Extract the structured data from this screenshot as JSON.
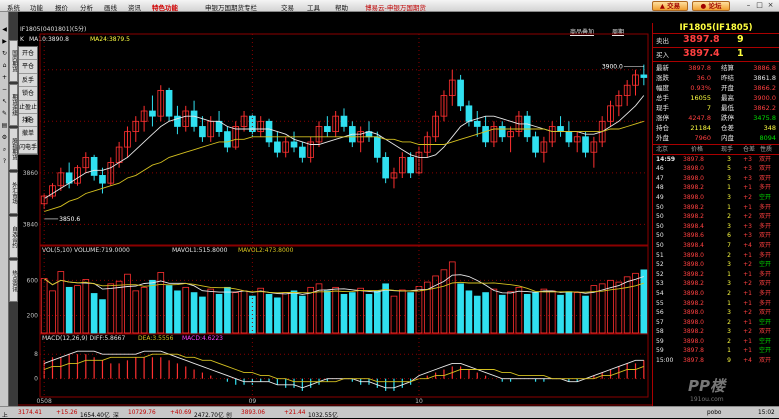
{
  "menu": [
    "系统",
    "功能",
    "报价",
    "分析",
    "画线",
    "资讯",
    "特色功能",
    "申银万国期货专栏",
    "交易",
    "工具",
    "帮助"
  ],
  "active_menu": "特色功能",
  "app_title": "博易云-申银万国期货",
  "trade_btn": "交易",
  "forum_btn": "论坛",
  "winctl": [
    "–",
    "□",
    "×"
  ],
  "toolbar_icons": [
    "back-icon",
    "forward-icon",
    "refresh-icon",
    "home-icon",
    "zoom-in-icon",
    "zoom-out-icon",
    "cursor-icon",
    "draw-icon",
    "print-icon",
    "settings-icon",
    "search-icon",
    "help-icon"
  ],
  "side_tabs": [
    "国内期货",
    "期货连续",
    "股指期货",
    "外汇市场",
    "自选合约",
    "热点资讯"
  ],
  "info": {
    "contract": "IF1805(0401801)(5分)",
    "k": "K",
    "ma10": "MA10:3890.8",
    "ma24": "MA24:3879.5",
    "link1": "商品叠加",
    "link2": "周期"
  },
  "vmenu": [
    "开仓",
    "平仓",
    "反手",
    "锁仓",
    "止盈止损",
    "持仓",
    "撤单",
    "闪电手"
  ],
  "vol_info": {
    "label": "VOL(5,10)",
    "volume": "VOLUME:719.0000",
    "mavol1": "MAVOL1:515.8000",
    "mavol2": "MAVOL2:473.8000"
  },
  "macd_info": {
    "label": "MACD(12,26,9)",
    "dif": "DIFF:5.8667",
    "dea": "DEA:3.5556",
    "macd": "MACD:4.6223"
  },
  "colors": {
    "up": "#ff3030",
    "down": "#30e0f0",
    "ma1": "#e8e8e8",
    "ma2": "#d4c020",
    "bg": "#000000",
    "grid": "#8b0000"
  },
  "chart_data": {
    "type": "candlestick",
    "yticks": [
      "3900",
      "3880",
      "3860",
      "3840"
    ],
    "ylim": [
      3832,
      3910
    ],
    "annotations": [
      {
        "text": "3900.0",
        "note": "high"
      },
      {
        "text": "3850.6",
        "note": "low"
      }
    ],
    "xticks": [
      "0508",
      "09",
      "10"
    ],
    "vol_yticks": [
      "600",
      "200"
    ],
    "macd_yticks": [
      "8",
      "0"
    ],
    "candles": [
      {
        "o": 3848,
        "h": 3852,
        "l": 3846,
        "c": 3851
      },
      {
        "o": 3851,
        "h": 3856,
        "l": 3850,
        "c": 3855
      },
      {
        "o": 3855,
        "h": 3862,
        "l": 3853,
        "c": 3860
      },
      {
        "o": 3860,
        "h": 3864,
        "l": 3854,
        "c": 3856
      },
      {
        "o": 3856,
        "h": 3863,
        "l": 3855,
        "c": 3862
      },
      {
        "o": 3862,
        "h": 3868,
        "l": 3860,
        "c": 3866
      },
      {
        "o": 3866,
        "h": 3867,
        "l": 3857,
        "c": 3859
      },
      {
        "o": 3859,
        "h": 3862,
        "l": 3852,
        "c": 3856
      },
      {
        "o": 3856,
        "h": 3866,
        "l": 3855,
        "c": 3864
      },
      {
        "o": 3864,
        "h": 3872,
        "l": 3862,
        "c": 3870
      },
      {
        "o": 3870,
        "h": 3878,
        "l": 3866,
        "c": 3876
      },
      {
        "o": 3876,
        "h": 3882,
        "l": 3872,
        "c": 3880
      },
      {
        "o": 3880,
        "h": 3886,
        "l": 3876,
        "c": 3884
      },
      {
        "o": 3884,
        "h": 3890,
        "l": 3878,
        "c": 3882
      },
      {
        "o": 3882,
        "h": 3894,
        "l": 3880,
        "c": 3892
      },
      {
        "o": 3892,
        "h": 3893,
        "l": 3880,
        "c": 3882
      },
      {
        "o": 3882,
        "h": 3886,
        "l": 3875,
        "c": 3878
      },
      {
        "o": 3878,
        "h": 3886,
        "l": 3876,
        "c": 3884
      },
      {
        "o": 3884,
        "h": 3888,
        "l": 3876,
        "c": 3878
      },
      {
        "o": 3878,
        "h": 3882,
        "l": 3872,
        "c": 3874
      },
      {
        "o": 3874,
        "h": 3882,
        "l": 3872,
        "c": 3880
      },
      {
        "o": 3880,
        "h": 3884,
        "l": 3874,
        "c": 3876
      },
      {
        "o": 3876,
        "h": 3878,
        "l": 3868,
        "c": 3870
      },
      {
        "o": 3870,
        "h": 3880,
        "l": 3869,
        "c": 3878
      },
      {
        "o": 3878,
        "h": 3884,
        "l": 3876,
        "c": 3882
      },
      {
        "o": 3882,
        "h": 3883,
        "l": 3874,
        "c": 3876
      },
      {
        "o": 3876,
        "h": 3882,
        "l": 3874,
        "c": 3880
      },
      {
        "o": 3880,
        "h": 3881,
        "l": 3870,
        "c": 3872
      },
      {
        "o": 3872,
        "h": 3876,
        "l": 3866,
        "c": 3868
      },
      {
        "o": 3868,
        "h": 3874,
        "l": 3866,
        "c": 3872
      },
      {
        "o": 3872,
        "h": 3876,
        "l": 3868,
        "c": 3870
      },
      {
        "o": 3870,
        "h": 3872,
        "l": 3864,
        "c": 3866
      },
      {
        "o": 3866,
        "h": 3874,
        "l": 3864,
        "c": 3872
      },
      {
        "o": 3872,
        "h": 3880,
        "l": 3870,
        "c": 3878
      },
      {
        "o": 3878,
        "h": 3882,
        "l": 3874,
        "c": 3876
      },
      {
        "o": 3876,
        "h": 3884,
        "l": 3874,
        "c": 3882
      },
      {
        "o": 3882,
        "h": 3885,
        "l": 3876,
        "c": 3878
      },
      {
        "o": 3878,
        "h": 3880,
        "l": 3870,
        "c": 3872
      },
      {
        "o": 3872,
        "h": 3878,
        "l": 3868,
        "c": 3876
      },
      {
        "o": 3876,
        "h": 3880,
        "l": 3872,
        "c": 3874
      },
      {
        "o": 3874,
        "h": 3876,
        "l": 3864,
        "c": 3866
      },
      {
        "o": 3866,
        "h": 3868,
        "l": 3856,
        "c": 3858
      },
      {
        "o": 3858,
        "h": 3862,
        "l": 3854,
        "c": 3860
      },
      {
        "o": 3860,
        "h": 3868,
        "l": 3858,
        "c": 3866
      },
      {
        "o": 3866,
        "h": 3868,
        "l": 3858,
        "c": 3860
      },
      {
        "o": 3860,
        "h": 3870,
        "l": 3859,
        "c": 3868
      },
      {
        "o": 3868,
        "h": 3876,
        "l": 3866,
        "c": 3874
      },
      {
        "o": 3874,
        "h": 3884,
        "l": 3872,
        "c": 3882
      },
      {
        "o": 3882,
        "h": 3892,
        "l": 3880,
        "c": 3890
      },
      {
        "o": 3890,
        "h": 3900,
        "l": 3886,
        "c": 3896
      },
      {
        "o": 3896,
        "h": 3898,
        "l": 3884,
        "c": 3886
      },
      {
        "o": 3886,
        "h": 3888,
        "l": 3878,
        "c": 3880
      },
      {
        "o": 3880,
        "h": 3884,
        "l": 3874,
        "c": 3878
      },
      {
        "o": 3878,
        "h": 3882,
        "l": 3870,
        "c": 3872
      },
      {
        "o": 3872,
        "h": 3880,
        "l": 3870,
        "c": 3878
      },
      {
        "o": 3878,
        "h": 3880,
        "l": 3872,
        "c": 3874
      },
      {
        "o": 3874,
        "h": 3878,
        "l": 3868,
        "c": 3876
      },
      {
        "o": 3876,
        "h": 3884,
        "l": 3874,
        "c": 3882
      },
      {
        "o": 3882,
        "h": 3884,
        "l": 3872,
        "c": 3874
      },
      {
        "o": 3874,
        "h": 3876,
        "l": 3866,
        "c": 3868
      },
      {
        "o": 3868,
        "h": 3874,
        "l": 3864,
        "c": 3872
      },
      {
        "o": 3872,
        "h": 3880,
        "l": 3870,
        "c": 3878
      },
      {
        "o": 3878,
        "h": 3882,
        "l": 3874,
        "c": 3876
      },
      {
        "o": 3876,
        "h": 3880,
        "l": 3870,
        "c": 3872
      },
      {
        "o": 3872,
        "h": 3876,
        "l": 3868,
        "c": 3874
      },
      {
        "o": 3874,
        "h": 3876,
        "l": 3866,
        "c": 3868
      },
      {
        "o": 3868,
        "h": 3874,
        "l": 3862,
        "c": 3872
      },
      {
        "o": 3872,
        "h": 3882,
        "l": 3870,
        "c": 3880
      },
      {
        "o": 3880,
        "h": 3888,
        "l": 3878,
        "c": 3886
      },
      {
        "o": 3886,
        "h": 3892,
        "l": 3882,
        "c": 3890
      },
      {
        "o": 3890,
        "h": 3896,
        "l": 3886,
        "c": 3894
      },
      {
        "o": 3894,
        "h": 3900,
        "l": 3890,
        "c": 3898
      },
      {
        "o": 3898,
        "h": 3902,
        "l": 3894,
        "c": 3897
      }
    ],
    "ma1": [
      3850,
      3852,
      3854,
      3856,
      3858,
      3860,
      3861,
      3861,
      3862,
      3864,
      3866,
      3869,
      3872,
      3875,
      3878,
      3880,
      3881,
      3882,
      3882,
      3881,
      3880,
      3880,
      3878,
      3877,
      3877,
      3877,
      3877,
      3877,
      3876,
      3875,
      3873,
      3872,
      3871,
      3871,
      3872,
      3873,
      3874,
      3875,
      3875,
      3876,
      3875,
      3873,
      3871,
      3869,
      3867,
      3866,
      3866,
      3867,
      3870,
      3874,
      3878,
      3880,
      3881,
      3882,
      3882,
      3881,
      3880,
      3879,
      3879,
      3878,
      3877,
      3876,
      3876,
      3876,
      3876,
      3875,
      3875,
      3876,
      3878,
      3880,
      3883,
      3886,
      3890
    ],
    "ma2": [
      3845,
      3846,
      3847,
      3849,
      3850,
      3852,
      3853,
      3854,
      3855,
      3856,
      3858,
      3859,
      3861,
      3863,
      3864,
      3866,
      3867,
      3868,
      3869,
      3870,
      3871,
      3872,
      3872,
      3873,
      3873,
      3874,
      3874,
      3874,
      3874,
      3874,
      3874,
      3874,
      3874,
      3874,
      3874,
      3874,
      3874,
      3874,
      3874,
      3874,
      3874,
      3873,
      3873,
      3872,
      3872,
      3871,
      3871,
      3871,
      3871,
      3872,
      3873,
      3874,
      3875,
      3876,
      3877,
      3877,
      3877,
      3877,
      3877,
      3877,
      3877,
      3876,
      3876,
      3876,
      3876,
      3876,
      3876,
      3876,
      3877,
      3877,
      3878,
      3879,
      3880
    ],
    "volume": [
      620,
      480,
      700,
      520,
      540,
      610,
      450,
      380,
      560,
      590,
      670,
      480,
      520,
      600,
      690,
      540,
      480,
      520,
      460,
      410,
      500,
      440,
      520,
      460,
      480,
      420,
      510,
      440,
      400,
      460,
      480,
      420,
      520,
      560,
      480,
      520,
      440,
      460,
      510,
      440,
      480,
      560,
      420,
      490,
      460,
      530,
      580,
      650,
      720,
      810,
      560,
      480,
      420,
      460,
      500,
      430,
      470,
      520,
      440,
      460,
      500,
      480,
      430,
      470,
      460,
      420,
      540,
      560,
      600,
      580,
      640,
      680,
      719
    ],
    "macd": [
      6,
      7,
      7,
      8,
      8,
      8,
      7,
      6,
      5,
      5,
      6,
      7,
      7,
      7,
      7,
      6,
      5,
      4,
      3,
      2,
      1,
      0,
      -1,
      -2,
      -2,
      -2,
      -1,
      -1,
      -2,
      -3,
      -3,
      -4,
      -3,
      -2,
      -1,
      0,
      0,
      -1,
      -2,
      -2,
      -3,
      -4,
      -4,
      -3,
      -2,
      0,
      1,
      2,
      3,
      4,
      4,
      3,
      2,
      1,
      0,
      -1,
      -1,
      0,
      0,
      -1,
      -1,
      0,
      0,
      -1,
      -1,
      0,
      1,
      2,
      3,
      4,
      5,
      5,
      6
    ],
    "dif": [
      5,
      6,
      7,
      8,
      9,
      9,
      9,
      8,
      8,
      8,
      8,
      8,
      9,
      9,
      9,
      8,
      7,
      6,
      5,
      4,
      3,
      2,
      1,
      0,
      -1,
      -1,
      -1,
      -1,
      -2,
      -2,
      -2,
      -3,
      -2,
      -1,
      0,
      0,
      0,
      0,
      -1,
      -1,
      -2,
      -3,
      -3,
      -2,
      -1,
      1,
      2,
      3,
      4,
      5,
      5,
      4,
      3,
      2,
      1,
      0,
      0,
      0,
      0,
      0,
      0,
      0,
      0,
      -1,
      -1,
      0,
      1,
      2,
      3,
      4,
      5,
      6,
      6
    ],
    "dea": [
      3,
      4,
      4,
      5,
      5,
      6,
      6,
      6,
      7,
      7,
      7,
      7,
      7,
      8,
      8,
      8,
      8,
      7,
      7,
      6,
      6,
      5,
      4,
      3,
      2,
      2,
      1,
      1,
      0,
      0,
      -1,
      -1,
      -1,
      -1,
      -1,
      -1,
      0,
      0,
      0,
      0,
      -1,
      -1,
      -1,
      -1,
      -1,
      0,
      0,
      1,
      1,
      2,
      3,
      3,
      3,
      3,
      3,
      2,
      2,
      1,
      1,
      1,
      1,
      0,
      0,
      0,
      0,
      0,
      0,
      1,
      1,
      2,
      3,
      3,
      4
    ]
  },
  "quote": {
    "title": "IF1805(IF1805)",
    "sell": {
      "label": "卖出",
      "price": "3897.8",
      "vol": "9"
    },
    "buy": {
      "label": "买入",
      "price": "3897.4",
      "vol": "1"
    },
    "fields": [
      {
        "l1": "最新",
        "v1": "3897.8",
        "c1": "red",
        "l2": "结算",
        "v2": "3886.8",
        "c2": "red"
      },
      {
        "l1": "涨跌",
        "v1": "36.0",
        "c1": "red",
        "l2": "昨结",
        "v2": "3861.8",
        "c2": "white"
      },
      {
        "l1": "幅度",
        "v1": "0.93%",
        "c1": "red",
        "l2": "开盘",
        "v2": "3866.2",
        "c2": "red"
      },
      {
        "l1": "总手",
        "v1": "16055",
        "c1": "yellow",
        "l2": "最高",
        "v2": "3900.0",
        "c2": "red"
      },
      {
        "l1": "现手",
        "v1": "7",
        "c1": "yellow",
        "l2": "最低",
        "v2": "3862.2",
        "c2": "red"
      },
      {
        "l1": "涨停",
        "v1": "4247.8",
        "c1": "red",
        "l2": "跌停",
        "v2": "3475.8",
        "c2": "green"
      },
      {
        "l1": "持仓",
        "v1": "21184",
        "c1": "yellow",
        "l2": "仓差",
        "v2": "348",
        "c2": "yellow"
      },
      {
        "l1": "外盘",
        "v1": "7960",
        "c1": "red",
        "l2": "内盘",
        "v2": "8094",
        "c2": "green"
      }
    ],
    "tick_header": [
      "北京",
      "价格",
      "现手",
      "仓差",
      "性质"
    ],
    "ticks": [
      {
        "t": "14:59",
        "p": "3897.8",
        "v": "3",
        "d": "+3",
        "n": "双开",
        "nc": "red"
      },
      {
        "t": "46",
        "p": "3898.0",
        "v": "5",
        "d": "+3",
        "n": "双开",
        "nc": "red"
      },
      {
        "t": "47",
        "p": "3898.0",
        "v": "3",
        "d": "+3",
        "n": "双开",
        "nc": "red"
      },
      {
        "t": "48",
        "p": "3898.2",
        "v": "1",
        "d": "+1",
        "n": "多开",
        "nc": "red"
      },
      {
        "t": "49",
        "p": "3898.0",
        "v": "3",
        "d": "+2",
        "n": "空开",
        "nc": "green"
      },
      {
        "t": "50",
        "p": "3898.2",
        "v": "1",
        "d": "+1",
        "n": "多开",
        "nc": "red"
      },
      {
        "t": "50",
        "p": "3898.2",
        "v": "2",
        "d": "+2",
        "n": "双开",
        "nc": "red"
      },
      {
        "t": "50",
        "p": "3898.4",
        "v": "3",
        "d": "+3",
        "n": "多开",
        "nc": "red"
      },
      {
        "t": "50",
        "p": "3898.6",
        "v": "6",
        "d": "+3",
        "n": "双开",
        "nc": "red"
      },
      {
        "t": "50",
        "p": "3898.4",
        "v": "7",
        "d": "+4",
        "n": "双开",
        "nc": "red"
      },
      {
        "t": "51",
        "p": "3898.0",
        "v": "2",
        "d": "+1",
        "n": "多开",
        "nc": "red"
      },
      {
        "t": "52",
        "p": "3898.0",
        "v": "3",
        "d": "+2",
        "n": "空开",
        "nc": "green"
      },
      {
        "t": "52",
        "p": "3898.2",
        "v": "1",
        "d": "+1",
        "n": "多开",
        "nc": "red"
      },
      {
        "t": "53",
        "p": "3898.2",
        "v": "3",
        "d": "+2",
        "n": "双开",
        "nc": "red"
      },
      {
        "t": "54",
        "p": "3898.0",
        "v": "2",
        "d": "+1",
        "n": "多开",
        "nc": "red"
      },
      {
        "t": "55",
        "p": "3898.2",
        "v": "1",
        "d": "+1",
        "n": "多开",
        "nc": "red"
      },
      {
        "t": "56",
        "p": "3898.0",
        "v": "3",
        "d": "+2",
        "n": "双开",
        "nc": "red"
      },
      {
        "t": "57",
        "p": "3898.0",
        "v": "2",
        "d": "+1",
        "n": "空开",
        "nc": "green"
      },
      {
        "t": "58",
        "p": "3898.2",
        "v": "3",
        "d": "+2",
        "n": "双开",
        "nc": "red"
      },
      {
        "t": "59",
        "p": "3898.0",
        "v": "2",
        "d": "+1",
        "n": "空开",
        "nc": "green"
      },
      {
        "t": "59",
        "p": "3897.8",
        "v": "1",
        "d": "+1",
        "n": "空开",
        "nc": "green"
      },
      {
        "t": "15:00",
        "p": "3897.8",
        "v": "9",
        "d": "+4",
        "n": "双开",
        "nc": "red"
      }
    ]
  },
  "status": [
    {
      "text": "上",
      "c": "#000"
    },
    {
      "text": "3174.41",
      "c": "#c00000"
    },
    {
      "text": "+15.26",
      "c": "#c00000"
    },
    {
      "text": "1654.40亿",
      "c": "#000"
    },
    {
      "text": "深",
      "c": "#000"
    },
    {
      "text": "10729.76",
      "c": "#c00000"
    },
    {
      "text": "+40.69",
      "c": "#c00000"
    },
    {
      "text": "2472.70亿",
      "c": "#000"
    },
    {
      "text": "创",
      "c": "#000"
    },
    {
      "text": "3893.06",
      "c": "#c00000"
    },
    {
      "text": "+21.44",
      "c": "#c00000"
    },
    {
      "text": "1032.55亿",
      "c": "#000"
    },
    {
      "text": "pobo",
      "c": "#000"
    },
    {
      "text": "15:02",
      "c": "#000"
    }
  ],
  "watermark": "PP楼",
  "watermark_sub": "191ou.com"
}
